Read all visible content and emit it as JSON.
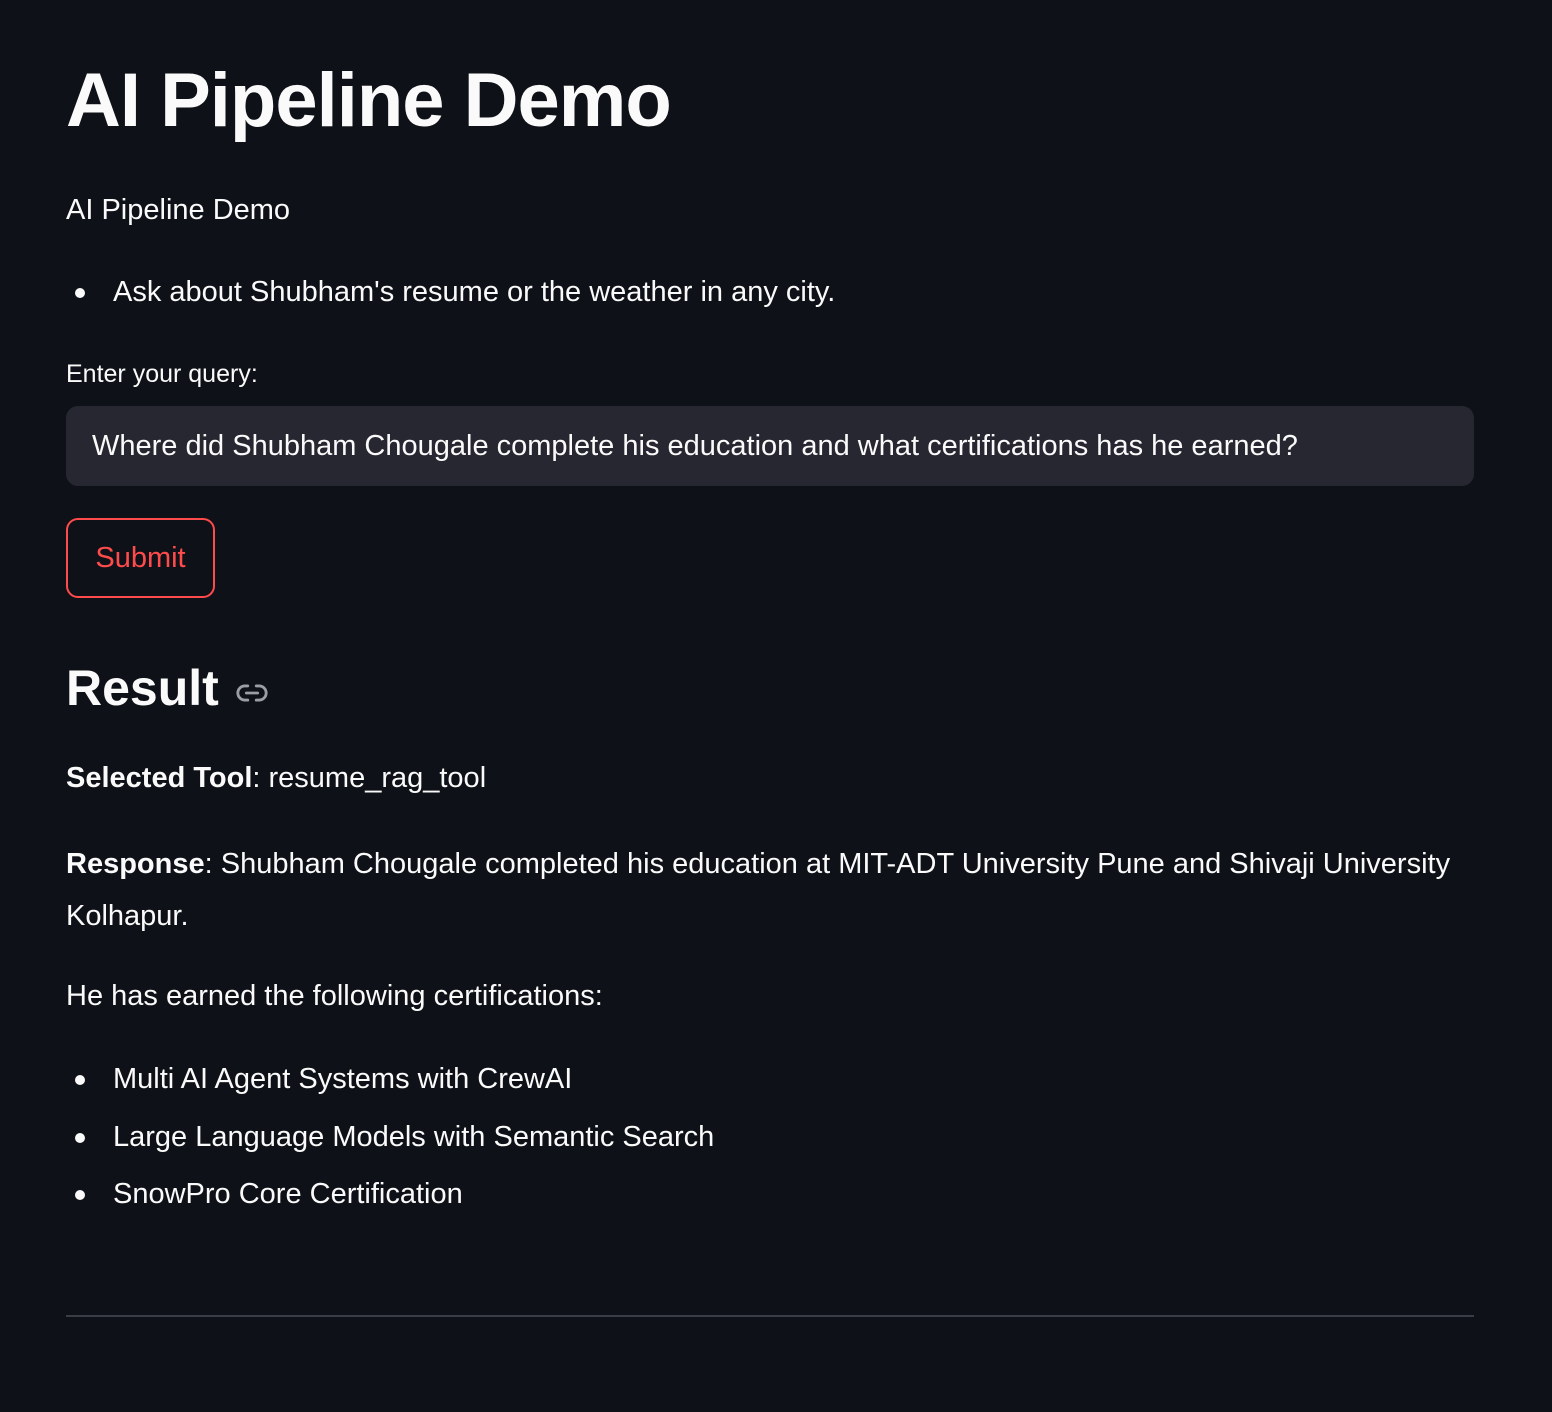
{
  "page": {
    "title": "AI Pipeline Demo",
    "caption": "AI Pipeline Demo",
    "intro_items": [
      "Ask about Shubham's resume or the weather in any city."
    ]
  },
  "query": {
    "label": "Enter your query:",
    "value": "Where did Shubham Chougale complete his education and what certifications has he earned?"
  },
  "submit": {
    "label": "Submit"
  },
  "result": {
    "heading": "Result",
    "link_icon": "link-icon",
    "selected_tool_label": "Selected Tool",
    "selected_tool_value": ": resume_rag_tool",
    "response_label": "Response",
    "response_text": ": Shubham Chougale completed his education at MIT-ADT University Pune and Shivaji University Kolhapur.",
    "certifications_intro": "He has earned the following certifications:",
    "certifications": [
      "Multi AI Agent Systems with CrewAI",
      "Large Language Models with Semantic Search",
      "SnowPro Core Certification"
    ]
  },
  "colors": {
    "background": "#0e1117",
    "text": "#fafafa",
    "input_background": "#262730",
    "accent": "#ff4b4b"
  }
}
